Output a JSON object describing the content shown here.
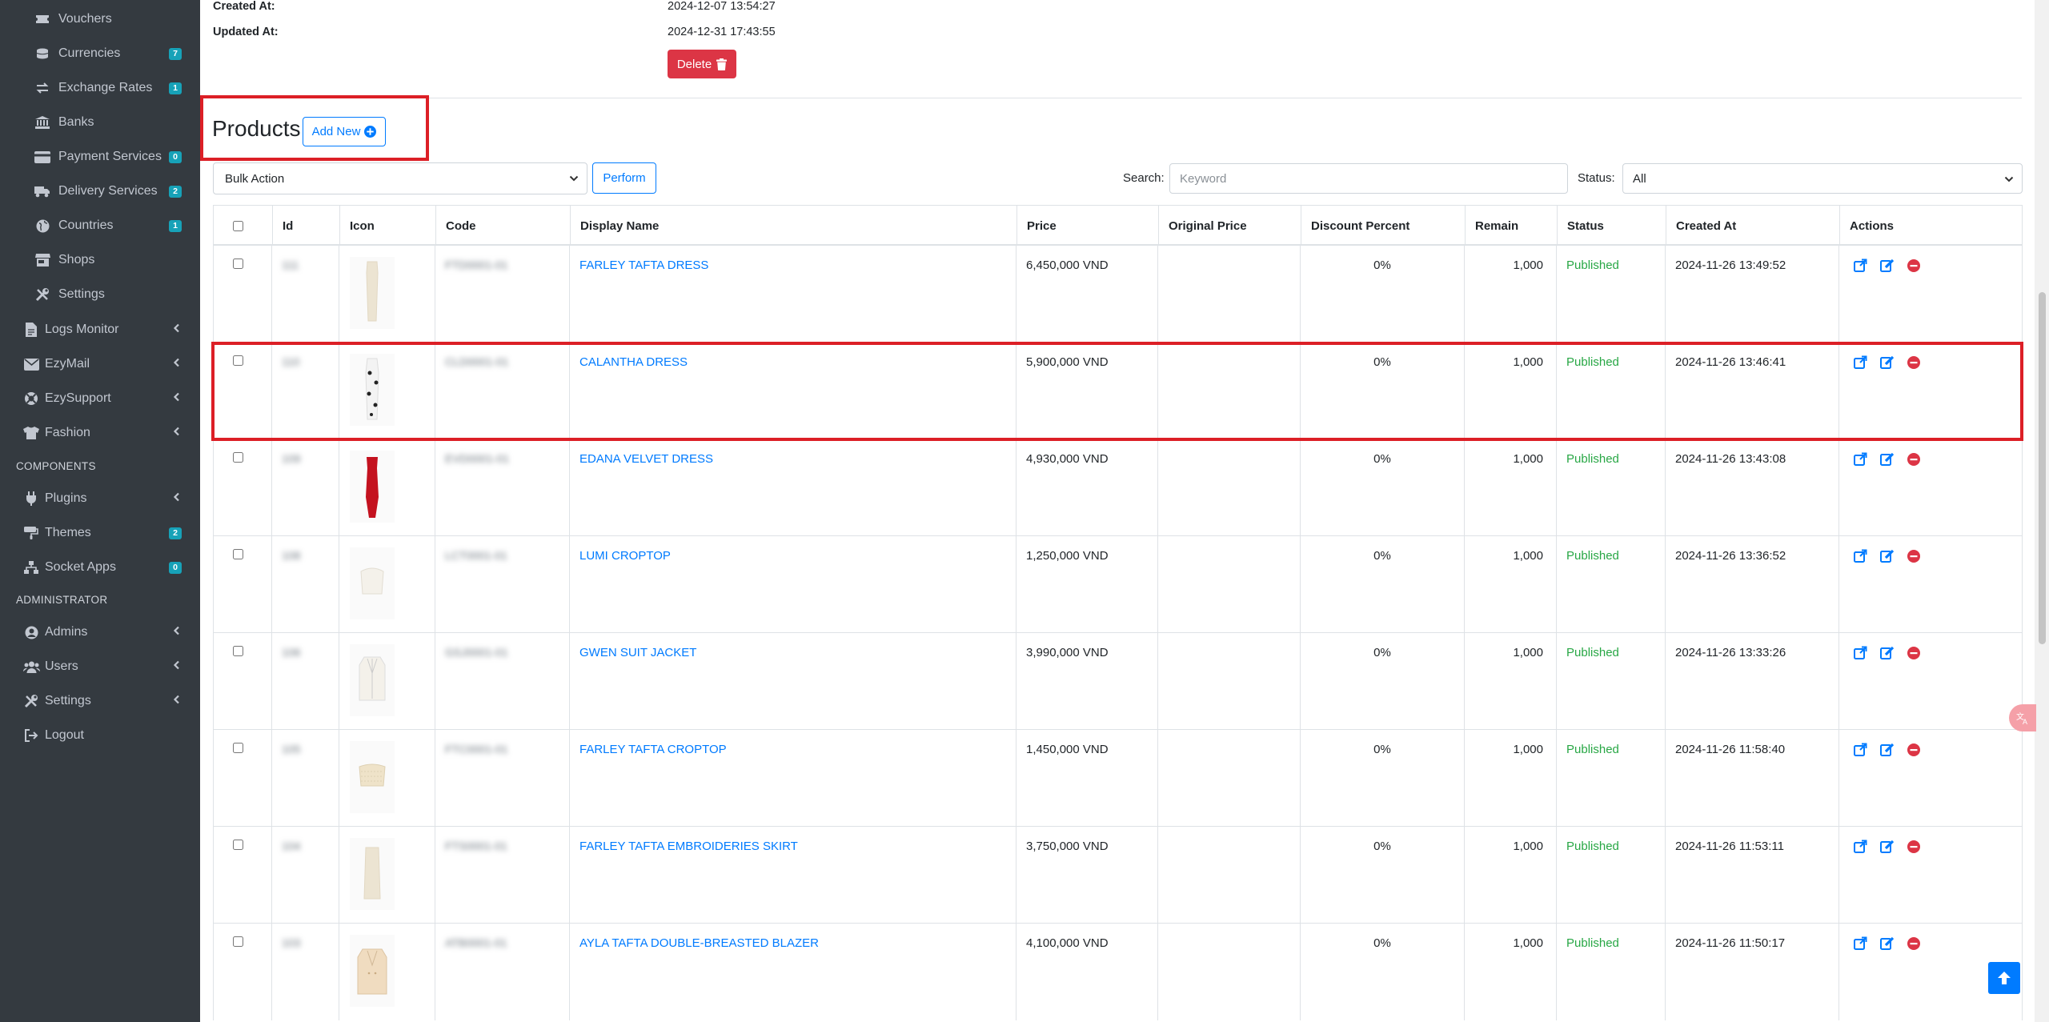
{
  "sidebar": {
    "items": [
      {
        "label": "Vouchers",
        "icon": "ticket-icon",
        "indent": true
      },
      {
        "label": "Currencies",
        "icon": "coins-icon",
        "badge": "7",
        "indent": true
      },
      {
        "label": "Exchange Rates",
        "icon": "exchange-icon",
        "badge": "1",
        "indent": true
      },
      {
        "label": "Banks",
        "icon": "bank-icon",
        "indent": true
      },
      {
        "label": "Payment Services",
        "icon": "credit-card-icon",
        "badge": "0",
        "indent": true
      },
      {
        "label": "Delivery Services",
        "icon": "truck-icon",
        "badge": "2",
        "indent": true
      },
      {
        "label": "Countries",
        "icon": "globe-icon",
        "badge": "1",
        "indent": true
      },
      {
        "label": "Shops",
        "icon": "store-icon",
        "indent": true
      },
      {
        "label": "Settings",
        "icon": "tools-icon",
        "indent": true
      },
      {
        "label": "Logs Monitor",
        "icon": "file-icon",
        "chevron": true
      },
      {
        "label": "EzyMail",
        "icon": "envelope-icon",
        "chevron": true
      },
      {
        "label": "EzySupport",
        "icon": "lifebuoy-icon",
        "chevron": true
      },
      {
        "label": "Fashion",
        "icon": "tshirt-icon",
        "chevron": true
      }
    ],
    "components_header": "COMPONENTS",
    "components": [
      {
        "label": "Plugins",
        "icon": "plug-icon",
        "chevron": true
      },
      {
        "label": "Themes",
        "icon": "paint-icon",
        "badge": "2"
      },
      {
        "label": "Socket Apps",
        "icon": "network-icon",
        "badge": "0"
      }
    ],
    "admin_header": "ADMINISTRATOR",
    "admin": [
      {
        "label": "Admins",
        "icon": "user-circle-icon",
        "chevron": true
      },
      {
        "label": "Users",
        "icon": "users-icon",
        "chevron": true
      },
      {
        "label": "Settings",
        "icon": "tools-icon",
        "chevron": true
      },
      {
        "label": "Logout",
        "icon": "sign-out-icon"
      }
    ]
  },
  "details": {
    "created_label": "Created At:",
    "created_value": "2024-12-07 13:54:27",
    "updated_label": "Updated At:",
    "updated_value": "2024-12-31 17:43:55",
    "delete_label": "Delete"
  },
  "products": {
    "title": "Products",
    "add_new_label": "Add New",
    "bulk_action_value": "Bulk Action",
    "perform_label": "Perform",
    "search_label": "Search:",
    "search_placeholder": "Keyword",
    "status_label": "Status:",
    "status_value": "All",
    "columns": [
      "Id",
      "Icon",
      "Code",
      "Display Name",
      "Price",
      "Original Price",
      "Discount Percent",
      "Remain",
      "Status",
      "Created At",
      "Actions"
    ],
    "rows": [
      {
        "id": "111",
        "code": "FTD0001-01",
        "name": "FARLEY TAFTA DRESS",
        "price": "6,450,000 VND",
        "original": "",
        "discount": "0%",
        "remain": "1,000",
        "status": "Published",
        "created": "2024-11-26 13:49:52",
        "thumb": "dress-cream"
      },
      {
        "id": "110",
        "code": "CLD0001-01",
        "name": "CALANTHA DRESS",
        "price": "5,900,000 VND",
        "original": "",
        "discount": "0%",
        "remain": "1,000",
        "status": "Published",
        "created": "2024-11-26 13:46:41",
        "thumb": "dress-dotted"
      },
      {
        "id": "109",
        "code": "EVD0001-01",
        "name": "EDANA VELVET DRESS",
        "price": "4,930,000 VND",
        "original": "",
        "discount": "0%",
        "remain": "1,000",
        "status": "Published",
        "created": "2024-11-26 13:43:08",
        "thumb": "dress-red"
      },
      {
        "id": "108",
        "code": "LCT0001-01",
        "name": "LUMI CROPTOP",
        "price": "1,250,000 VND",
        "original": "",
        "discount": "0%",
        "remain": "1,000",
        "status": "Published",
        "created": "2024-11-26 13:36:52",
        "thumb": "croptop"
      },
      {
        "id": "106",
        "code": "GSJ0001-01",
        "name": "GWEN SUIT JACKET",
        "price": "3,990,000 VND",
        "original": "",
        "discount": "0%",
        "remain": "1,000",
        "status": "Published",
        "created": "2024-11-26 13:33:26",
        "thumb": "jacket"
      },
      {
        "id": "105",
        "code": "FTC0001-01",
        "name": "FARLEY TAFTA CROPTOP",
        "price": "1,450,000 VND",
        "original": "",
        "discount": "0%",
        "remain": "1,000",
        "status": "Published",
        "created": "2024-11-26 11:58:40",
        "thumb": "croptop-textured"
      },
      {
        "id": "104",
        "code": "FTS0001-01",
        "name": "FARLEY TAFTA EMBROIDERIES SKIRT",
        "price": "3,750,000 VND",
        "original": "",
        "discount": "0%",
        "remain": "1,000",
        "status": "Published",
        "created": "2024-11-26 11:53:11",
        "thumb": "skirt"
      },
      {
        "id": "103",
        "code": "ATB0001-01",
        "name": "AYLA TAFTA DOUBLE-BREASTED BLAZER",
        "price": "4,100,000 VND",
        "original": "",
        "discount": "0%",
        "remain": "1,000",
        "status": "Published",
        "created": "2024-11-26 11:50:17",
        "thumb": "blazer"
      }
    ]
  },
  "colors": {
    "sidebar_bg": "#343a40",
    "badge": "#17a2b8",
    "link": "#007bff",
    "published": "#28a745",
    "danger": "#dc3545",
    "highlight": "#dc1f26"
  }
}
